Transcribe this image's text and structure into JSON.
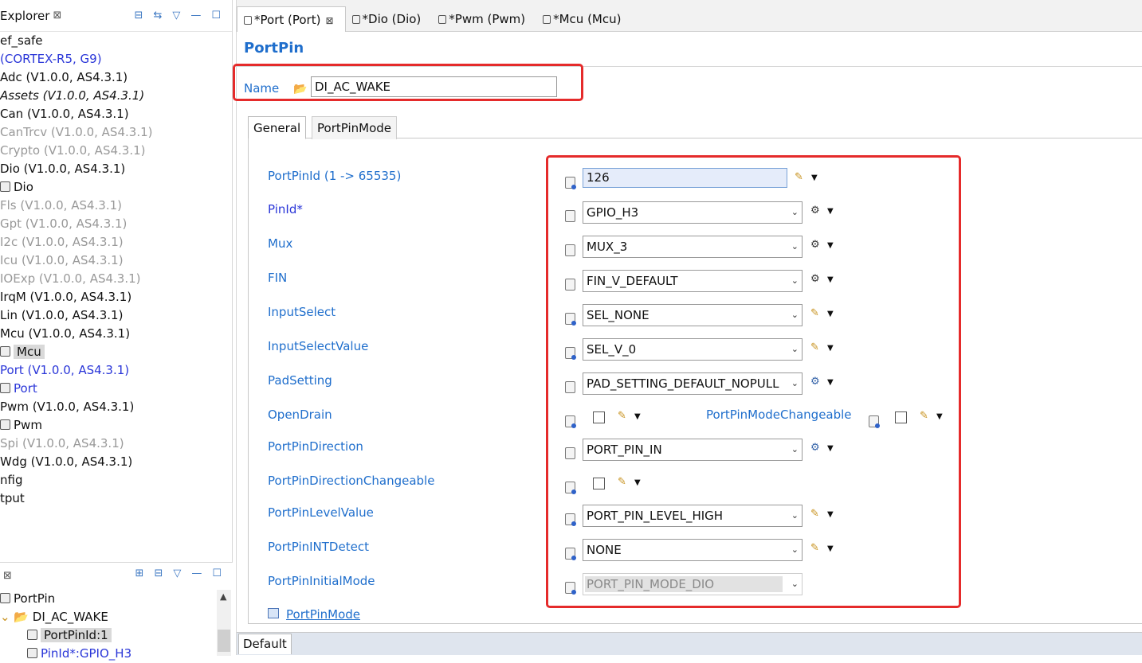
{
  "left_panel": {
    "title": "Explorer",
    "close": "⊠",
    "tools": [
      "⊟",
      "⇆",
      "▽",
      "—",
      "☐"
    ],
    "tree": [
      {
        "label": "ef_safe",
        "style": "normal"
      },
      {
        "label": " (CORTEX-R5, G9)",
        "style": "blue"
      },
      {
        "label": "Adc (V1.0.0, AS4.3.1)",
        "style": "normal"
      },
      {
        "label": "Assets (V1.0.0, AS4.3.1)",
        "style": "italic"
      },
      {
        "label": "Can (V1.0.0, AS4.3.1)",
        "style": "normal"
      },
      {
        "label": "CanTrcv (V1.0.0, AS4.3.1)",
        "style": "gray"
      },
      {
        "label": "Crypto (V1.0.0, AS4.3.1)",
        "style": "gray"
      },
      {
        "label": "Dio (V1.0.0, AS4.3.1)",
        "style": "normal"
      },
      {
        "label": "Dio",
        "style": "normal",
        "icon": true
      },
      {
        "label": "Fls (V1.0.0, AS4.3.1)",
        "style": "gray"
      },
      {
        "label": "Gpt (V1.0.0, AS4.3.1)",
        "style": "gray"
      },
      {
        "label": "I2c (V1.0.0, AS4.3.1)",
        "style": "gray"
      },
      {
        "label": "Icu (V1.0.0, AS4.3.1)",
        "style": "gray"
      },
      {
        "label": "IOExp (V1.0.0, AS4.3.1)",
        "style": "gray"
      },
      {
        "label": "IrqM (V1.0.0, AS4.3.1)",
        "style": "normal"
      },
      {
        "label": "Lin (V1.0.0, AS4.3.1)",
        "style": "normal"
      },
      {
        "label": "Mcu (V1.0.0, AS4.3.1)",
        "style": "normal"
      },
      {
        "label": "Mcu",
        "style": "selected",
        "icon": true
      },
      {
        "label": "Port (V1.0.0, AS4.3.1)",
        "style": "blue"
      },
      {
        "label": "Port",
        "style": "blue",
        "icon": true
      },
      {
        "label": "Pwm (V1.0.0, AS4.3.1)",
        "style": "normal"
      },
      {
        "label": "Pwm",
        "style": "normal",
        "icon": true
      },
      {
        "label": "Spi (V1.0.0, AS4.3.1)",
        "style": "gray"
      },
      {
        "label": "Wdg (V1.0.0, AS4.3.1)",
        "style": "normal"
      },
      {
        "label": "nfig",
        "style": "normal"
      },
      {
        "label": "tput",
        "style": "normal"
      }
    ]
  },
  "outline_panel": {
    "close": "⊠",
    "tools": [
      "⊞",
      "⊟",
      "▽",
      "—",
      "☐"
    ],
    "tree": [
      {
        "label": "PortPin",
        "style": "normal",
        "icon": true
      },
      {
        "label": "DI_AC_WAKE",
        "style": "normal",
        "prefix": "⌄ 📂"
      },
      {
        "label": "PortPinId:1",
        "style": "selected",
        "icon": true
      },
      {
        "label": "PinId*:GPIO_H3",
        "style": "blue",
        "icon": true
      }
    ]
  },
  "editor": {
    "tabs": [
      {
        "label": "*Port (Port)",
        "active": true,
        "close": "⊠"
      },
      {
        "label": "*Dio (Dio)",
        "active": false
      },
      {
        "label": "*Pwm (Pwm)",
        "active": false
      },
      {
        "label": "*Mcu (Mcu)",
        "active": false
      }
    ],
    "page_title": "PortPin",
    "name_label": "Name",
    "name_value": "DI_AC_WAKE",
    "subtabs": [
      "General",
      "PortPinMode"
    ],
    "fields": [
      {
        "label": "PortPinId (1 -> 65535)",
        "kind": "text",
        "value": "126",
        "action": "pencil"
      },
      {
        "label": "PinId*",
        "kind": "select",
        "value": "GPIO_H3",
        "action": "gear",
        "dark": true
      },
      {
        "label": "Mux",
        "kind": "select",
        "value": "MUX_3",
        "action": "gear"
      },
      {
        "label": "FIN",
        "kind": "select",
        "value": "FIN_V_DEFAULT",
        "action": "gear"
      },
      {
        "label": "InputSelect",
        "kind": "select",
        "value": "SEL_NONE",
        "action": "pencil"
      },
      {
        "label": "InputSelectValue",
        "kind": "select",
        "value": "SEL_V_0",
        "action": "pencil"
      },
      {
        "label": "PadSetting",
        "kind": "select",
        "value": "PAD_SETTING_DEFAULT_NOPULL",
        "action": "gearblue"
      },
      {
        "label": "OpenDrain",
        "kind": "check",
        "value": "",
        "action": "pencil"
      },
      {
        "label": "PortPinDirection",
        "kind": "select",
        "value": "PORT_PIN_IN",
        "action": "gearblue"
      },
      {
        "label": "PortPinDirectionChangeable",
        "kind": "check",
        "value": "",
        "action": "pencil"
      },
      {
        "label": "PortPinLevelValue",
        "kind": "select",
        "value": "PORT_PIN_LEVEL_HIGH",
        "action": "pencil"
      },
      {
        "label": "PortPinINTDetect",
        "kind": "select",
        "value": "NONE",
        "action": "pencil"
      },
      {
        "label": "PortPinInitialMode",
        "kind": "disabled",
        "value": "PORT_PIN_MODE_DIO",
        "action": "none"
      }
    ],
    "mode_changeable_label": "PortPinModeChangeable",
    "link_label": "PortPinMode",
    "bottom_tab": "Default"
  },
  "icons": {
    "pencil": "✎",
    "gear": "⚙",
    "dropdown": "▼",
    "select_arrow": "⌄",
    "folder": "📂"
  },
  "colors": {
    "label_blue": "#1f6ecc",
    "link_blue": "#2a36d8",
    "highlight_red": "#e52b2b"
  }
}
